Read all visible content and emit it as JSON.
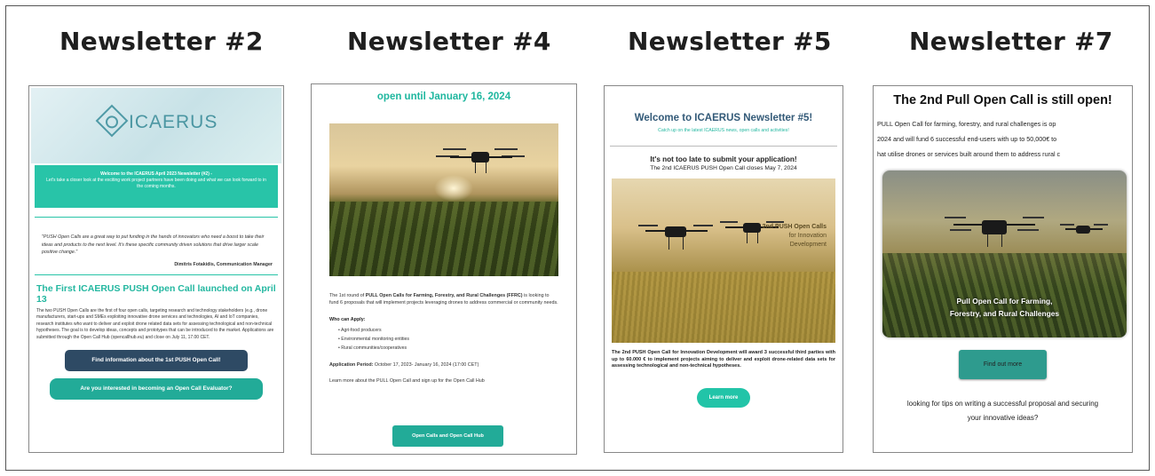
{
  "titles": [
    "Newsletter #2",
    "Newsletter #4",
    "Newsletter #5",
    "Newsletter #7"
  ],
  "n2": {
    "logo": "ICAERUS",
    "banner_line1": "Welcome to the ICAERUS April 2023 Newsletter (#2) -",
    "banner_line2": "Let's take a closer look at the exciting work project partners have been doing and what we can look forward to in the coming months.",
    "quote": "\"PUSH Open Calls are a great way to put funding in the hands of innovators who need a boost to take their ideas and products to the next level. It's these specific community driven solutions that drive larger scale positive change.\"",
    "signature": "Dimitris Fotakidis, Communication Manager",
    "heading": "The First ICAERUS PUSH Open Call launched on April 13",
    "body": "The two PUSH Open Calls are the first of four open calls, targeting research and technology stakeholders (e.g., drone manufacturers, start-ups and SMEs exploiting innovative drone services and technologies, AI and IoT companies, research institutes who want to deliver and exploit drone related data sets for assessing technological and non-technical hypotheses. The goal is to develop ideas, concepts and prototypes that can be introduced to the market. Applications are submitted through the Open Call Hub (opencallhub.eu) and close on July 11, 17.00 CET.",
    "button1": "Find information about the 1st PUSH Open Call!",
    "button2": "Are you interested in becoming an Open Call Evaluator?"
  },
  "n4": {
    "open_until": "open until January 16, 2024",
    "intro_plain": "The 1st round of ",
    "intro_bold": "PULL Open Calls for Farming, Forestry, and Rural Challenges (FFRC)",
    "intro_rest": " is looking to fund 6 proposals that will implement projects leveraging drones to address commercial or community needs.",
    "who_heading": "Who can Apply:",
    "who_items": [
      "Agri-food producers",
      "Environmental monitoring entities",
      "Rural communities/cooperatives"
    ],
    "period_label": "Application Period:",
    "period_value": " October 17, 2023- January 16, 2024 (17:00 CET)",
    "learn_more": "Learn more about  the PULL Open Call and sign up for the Open Call Hub",
    "button": "Open Calls and Open Call Hub"
  },
  "n5": {
    "welcome": "Welcome to ICAERUS Newsletter #5!",
    "catch_up": "Catch up on the latest ICAERUS news, open calls and activities!",
    "not_late": "It's not too late to submit your application!",
    "closes": "The 2nd ICAERUS PUSH Open Call closes May 7, 2024",
    "image_caption_1": "2nd PUSH Open Calls",
    "image_caption_2": "for Innovation",
    "image_caption_3": "Development",
    "body": "The 2nd PUSH Open Call for Innovation Development will award 3 successful third parties with up to 60.000 € to implement projects aiming to deliver and exploit drone-related data sets for assessing technological and non-technical hypotheses.",
    "button": "Learn more"
  },
  "n7": {
    "title": "The 2nd Pull Open Call is still open!",
    "body_line1": "PULL Open Call for farming, forestry, and rural challenges is op",
    "body_line2": "2024 and will fund 6 successful end-users with up to 50,000€ to",
    "body_line3": "hat utilise drones or services built around them to address rural c",
    "image_caption_1": "Pull Open Call for Farming,",
    "image_caption_2": "Forestry, and Rural Challenges",
    "button": "Find out more",
    "tips_line1": "looking for tips on writing a successful proposal and securing",
    "tips_line2": "your innovative ideas?"
  }
}
